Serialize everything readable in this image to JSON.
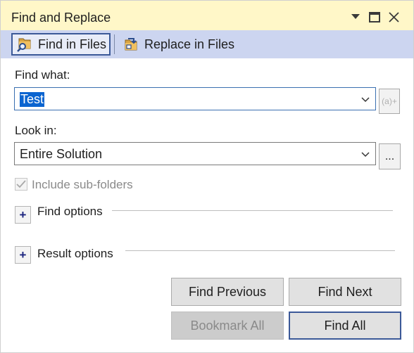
{
  "window": {
    "title": "Find and Replace",
    "title_bar_color": "#fff7c8",
    "tab_strip_color": "#ccd5f0"
  },
  "tabs": [
    {
      "label": "Find in Files",
      "icon": "find-in-files-icon",
      "active": true
    },
    {
      "label": "Replace in Files",
      "icon": "replace-in-files-icon",
      "active": false
    }
  ],
  "find": {
    "label": "Find what:",
    "value": "Test",
    "selection_color": "#0a64d0",
    "regex_button_label": "(a)+"
  },
  "look_in": {
    "label": "Look in:",
    "value": "Entire Solution",
    "browse_label": "..."
  },
  "include_subfolders": {
    "label": "Include sub-folders",
    "checked": true,
    "enabled": false
  },
  "expanders": [
    {
      "label": "Find options",
      "symbol": "+"
    },
    {
      "label": "Result options",
      "symbol": "+"
    }
  ],
  "buttons": {
    "find_previous": "Find Previous",
    "find_next": "Find Next",
    "bookmark_all": "Bookmark All",
    "find_all": "Find All"
  }
}
